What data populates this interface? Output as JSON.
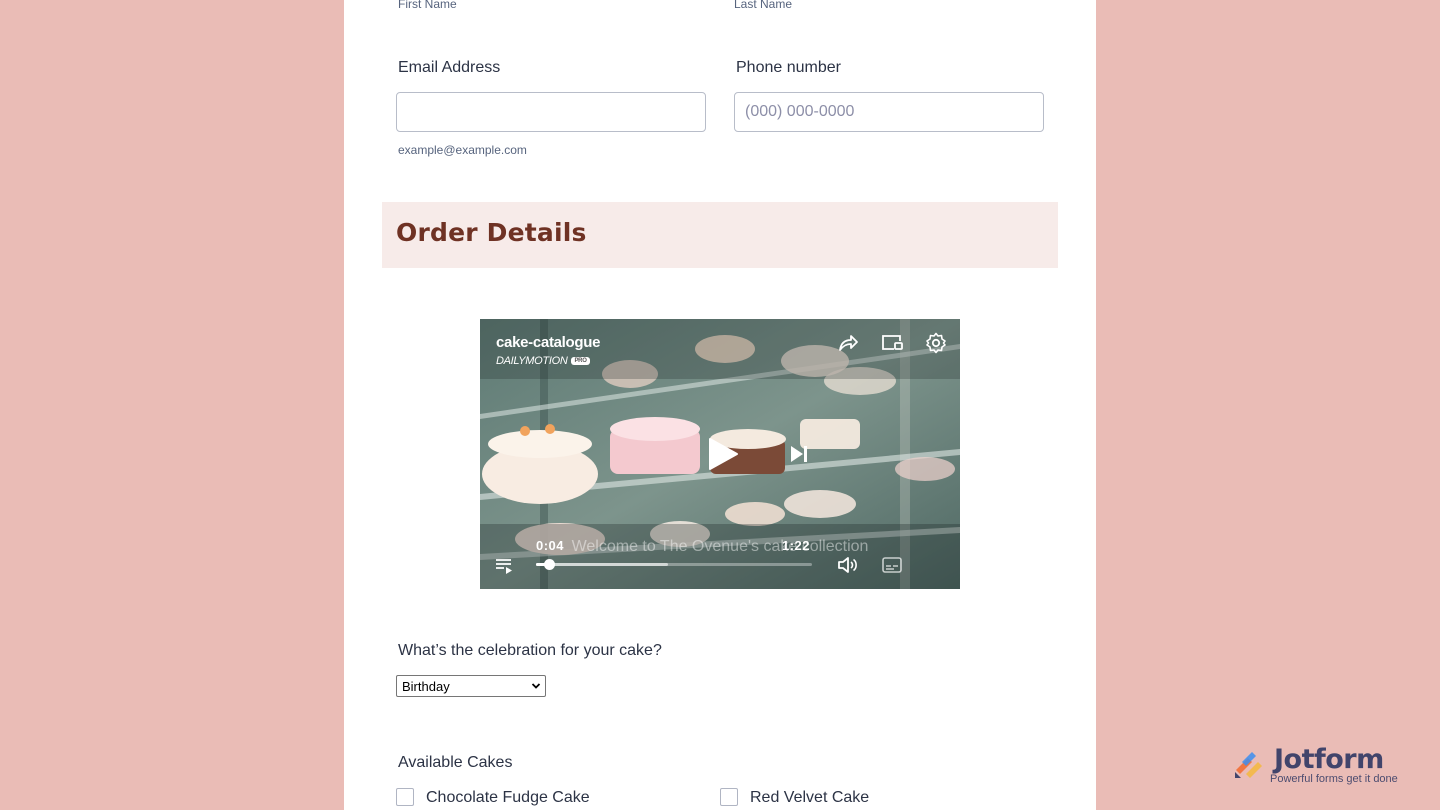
{
  "name_field": {
    "first_sublabel": "First Name",
    "last_sublabel": "Last Name"
  },
  "email": {
    "label": "Email Address",
    "value": "",
    "placeholder": "",
    "hint": "example@example.com"
  },
  "phone": {
    "label": "Phone number",
    "value": "",
    "placeholder": "(000) 000-0000"
  },
  "section": {
    "title": "Order Details"
  },
  "video": {
    "title": "cake-catalogue",
    "brand": "DAILYMOTION",
    "brand_badge": "PRO",
    "current_time": "0:04",
    "duration": "1:22",
    "caption": "Welcome to The Ovenue's cake collection",
    "progress_fraction": 0.047,
    "buffered_fraction": 0.48,
    "icons": [
      "share-icon",
      "cast-icon",
      "settings-icon",
      "play-icon",
      "skip-next-icon",
      "playlist-icon",
      "volume-icon",
      "subtitles-icon"
    ]
  },
  "celebration": {
    "label": "What’s the celebration for your cake?",
    "selected": "Birthday"
  },
  "cakes": {
    "label": "Available Cakes",
    "options": [
      "Chocolate Fudge Cake",
      "Red Velvet Cake"
    ]
  },
  "branding": {
    "name": "Jotform",
    "tagline": "Powerful forms get it done"
  },
  "colors": {
    "page_bg": "#eabcb6",
    "section_bg": "#f7ebe9",
    "section_title": "#6f3224",
    "arrow": "#f07c1a"
  }
}
